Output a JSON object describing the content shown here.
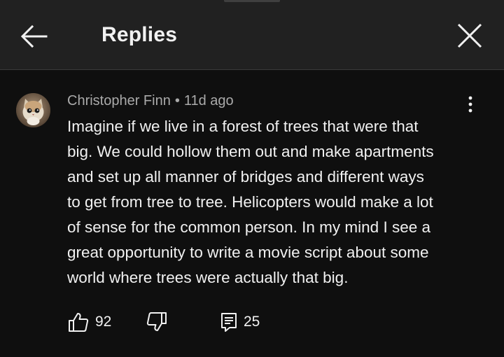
{
  "header": {
    "title": "Replies",
    "back_icon": "arrow-left-icon",
    "close_icon": "close-icon"
  },
  "comment": {
    "author": "Christopher Finn",
    "separator": "•",
    "time_ago": "11d ago",
    "text_lines": [
      "Imagine if we live in a forest of trees that were that",
      "big. We could hollow them out and make apartments",
      "and set up all manner of bridges and different ways",
      "to get from tree to tree. Helicopters would make a lot",
      "of sense for the common person. In my mind I see a",
      "great opportunity to write a movie script about some",
      "world where trees were actually that big."
    ],
    "likes": "92",
    "replies": "25",
    "more_icon": "more-vert-icon",
    "like_icon": "thumb-up-icon",
    "dislike_icon": "thumb-down-icon",
    "reply_icon": "comment-icon"
  },
  "colors": {
    "background": "#0f0f0f",
    "header_background": "#212121",
    "primary_text": "#f1f1f1",
    "secondary_text": "#aaaaaa"
  }
}
